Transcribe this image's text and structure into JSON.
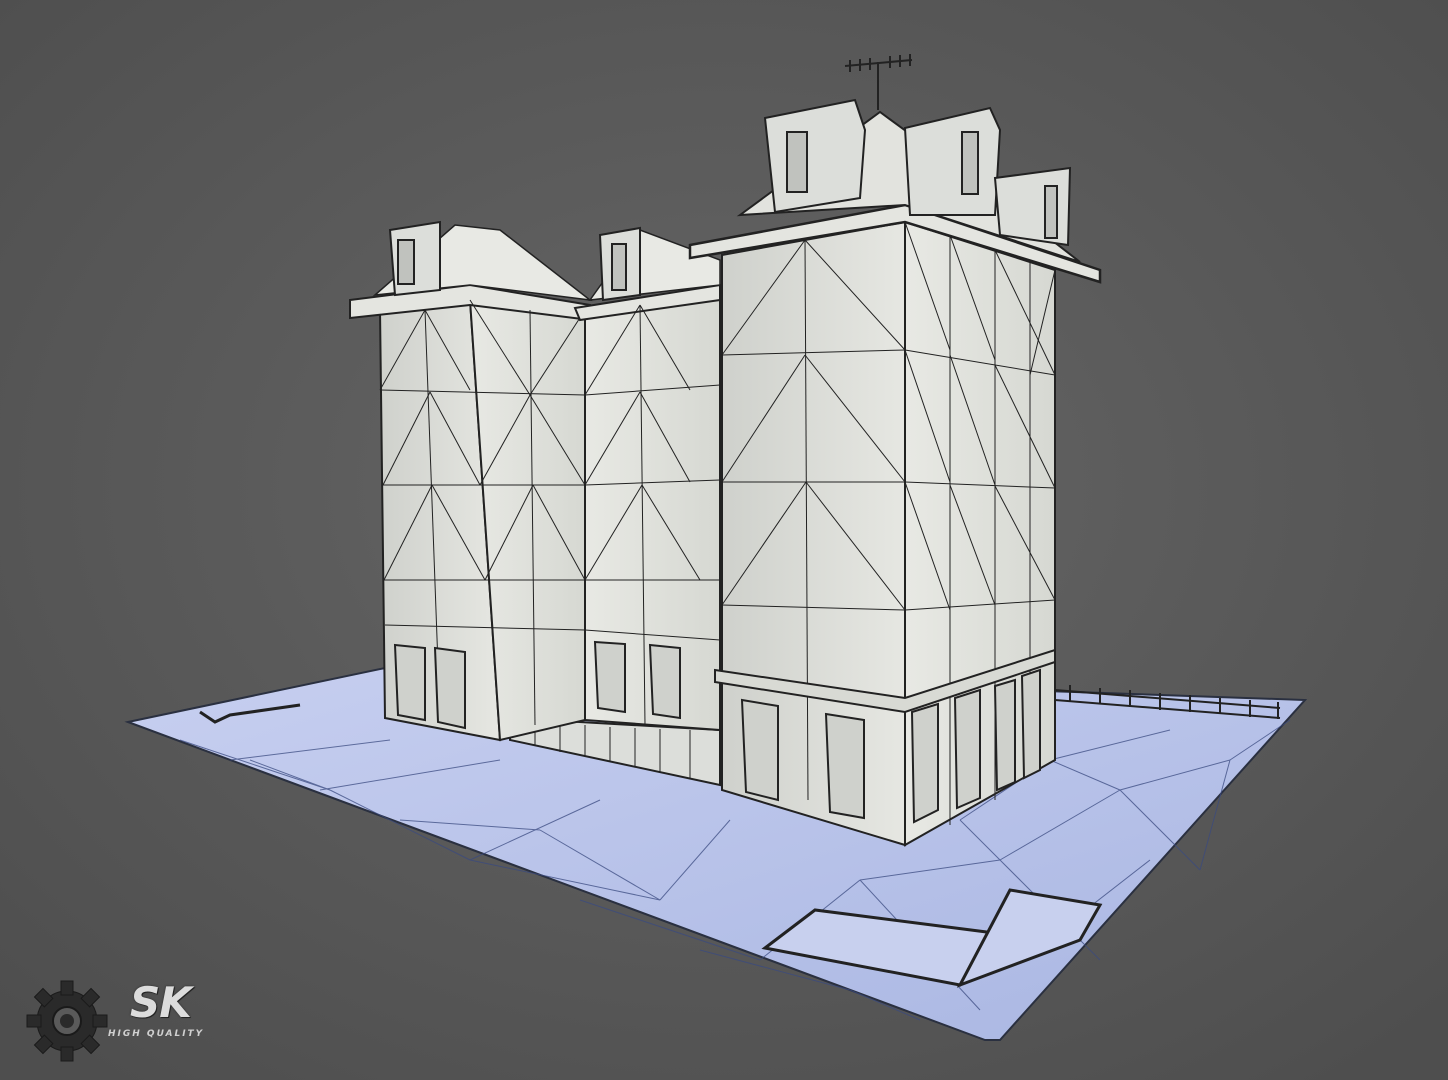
{
  "scene": {
    "background_color": "#5a5a5a",
    "ground_color": "#b9c3e6",
    "wall_color": "#dcdeda",
    "wire_color": "#1e2230"
  },
  "logo": {
    "icon": "gear-icon",
    "mark": "SK",
    "tagline": "HIGH QUALITY"
  }
}
